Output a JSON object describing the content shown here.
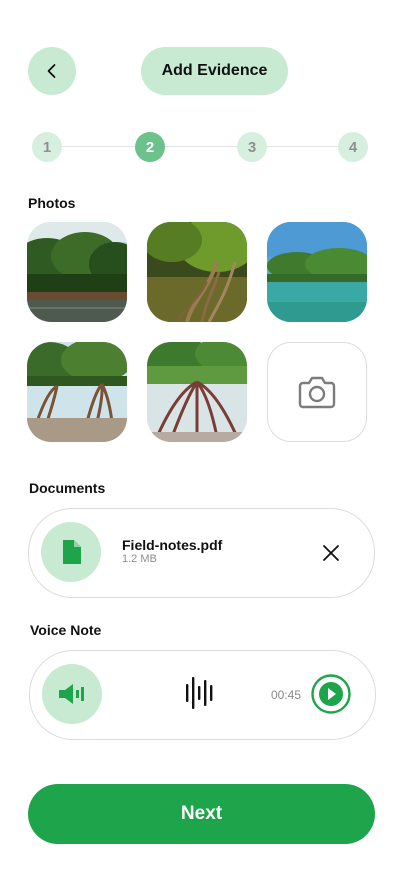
{
  "header": {
    "title": "Add Evidence",
    "back_icon": "chevron-left-icon"
  },
  "stepper": {
    "current": 2,
    "steps": [
      "1",
      "2",
      "3",
      "4"
    ]
  },
  "photos": {
    "label": "Photos",
    "items": [
      "mangrove-photo-1",
      "mangrove-photo-2",
      "mangrove-photo-3",
      "mangrove-photo-4",
      "mangrove-photo-5"
    ],
    "add_icon": "camera-icon"
  },
  "documents": {
    "label": "Documents",
    "file_name": "Field-notes.pdf",
    "file_size": "1.2 MB",
    "file_icon": "document-icon",
    "remove_icon": "close-icon"
  },
  "voice_note": {
    "label": "Voice Note",
    "duration": "00:45",
    "speaker_icon": "speaker-icon",
    "waveform_icon": "waveform-icon",
    "play_icon": "play-icon"
  },
  "footer": {
    "next_label": "Next"
  },
  "colors": {
    "accent": "#1ea44a",
    "accent_light": "#c9ead2",
    "step_active": "#6cc28b",
    "step_inactive": "#d6efde"
  }
}
